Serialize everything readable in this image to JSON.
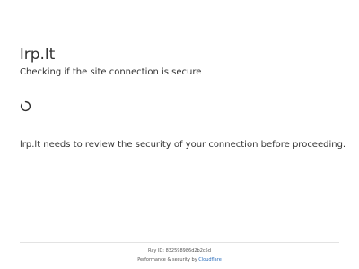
{
  "header": {
    "site_title": "lrp.lt",
    "subtitle": "Checking if the site connection is secure"
  },
  "main": {
    "spinner_icon": "loading-spinner-icon",
    "message": "lrp.lt needs to review the security of your connection before proceeding."
  },
  "footer": {
    "ray_id_label": "Ray ID:",
    "ray_id_value": "832598986d2b2c5d",
    "performance_text": "Performance & security by",
    "provider_link": "Cloudflare"
  },
  "colors": {
    "text": "#313131",
    "muted": "#555555",
    "link": "#2d6fbd",
    "divider": "#e3e3e3"
  }
}
